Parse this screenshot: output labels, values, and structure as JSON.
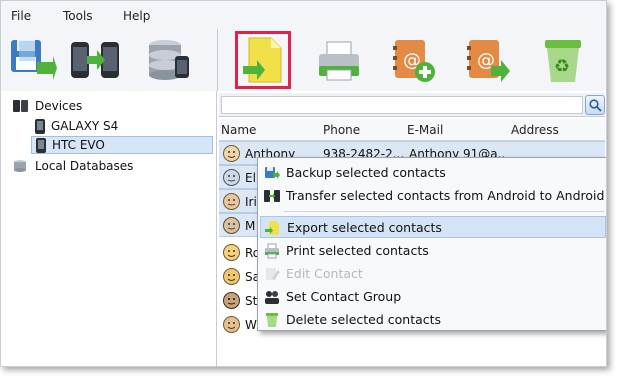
{
  "menubar": {
    "file": "File",
    "tools": "Tools",
    "help": "Help"
  },
  "toolbar": {
    "buttons": [
      {
        "name": "backup-to-disk",
        "icon": "floppy-disk-icon"
      },
      {
        "name": "phone-transfer",
        "icon": "phones-transfer-icon"
      },
      {
        "name": "database",
        "icon": "database-icon"
      },
      {
        "name": "export",
        "icon": "export-file-icon",
        "selected": true
      },
      {
        "name": "print",
        "icon": "printer-icon"
      },
      {
        "name": "add-contact",
        "icon": "address-book-add-icon"
      },
      {
        "name": "send-contact",
        "icon": "address-book-export-icon"
      },
      {
        "name": "delete",
        "icon": "recycle-bin-icon"
      }
    ]
  },
  "tree": {
    "devices": "Devices",
    "device1": "GALAXY S4",
    "device2": "HTC EVO",
    "local_databases": "Local Databases"
  },
  "search": {
    "placeholder": ""
  },
  "table": {
    "columns": [
      "Name",
      "Phone",
      "E-Mail",
      "Address"
    ],
    "rows": [
      {
        "name": "Anthony",
        "phone": "938-2482-2...",
        "email": "Anthony 91@a...",
        "address": "",
        "selected": true
      },
      {
        "name": "El",
        "phone": "",
        "email": "",
        "address": "",
        "selected": true
      },
      {
        "name": "Iri",
        "phone": "",
        "email": "",
        "address": "",
        "selected": true
      },
      {
        "name": "M",
        "phone": "",
        "email": "",
        "address": "",
        "selected": true
      },
      {
        "name": "Ro",
        "phone": "",
        "email": "",
        "address": "",
        "selected": false
      },
      {
        "name": "Sa",
        "phone": "",
        "email": "",
        "address": "",
        "selected": false
      },
      {
        "name": "Ste",
        "phone": "",
        "email": "",
        "address": "",
        "selected": false
      },
      {
        "name": "William",
        "phone": "",
        "email": "",
        "address": "",
        "selected": false
      }
    ]
  },
  "context_menu": {
    "items": [
      {
        "label": "Backup selected contacts",
        "icon": "backup-icon",
        "state": "normal"
      },
      {
        "label": "Transfer selected contacts from Android to Android",
        "icon": "phones-transfer-icon",
        "state": "normal"
      },
      {
        "label": "Export selected contacts",
        "icon": "export-file-icon",
        "state": "hover"
      },
      {
        "label": "Print selected contacts",
        "icon": "printer-icon",
        "state": "normal"
      },
      {
        "label": "Edit Contact",
        "icon": "edit-icon",
        "state": "disabled"
      },
      {
        "label": "Set Contact Group",
        "icon": "group-icon",
        "state": "normal"
      },
      {
        "label": "Delete selected contacts",
        "icon": "recycle-bin-icon",
        "state": "normal"
      }
    ]
  },
  "colors": {
    "accent_selected_border": "#e0234e",
    "selection": "#dbe7f5",
    "menu_hover": "#d4e4f6"
  }
}
